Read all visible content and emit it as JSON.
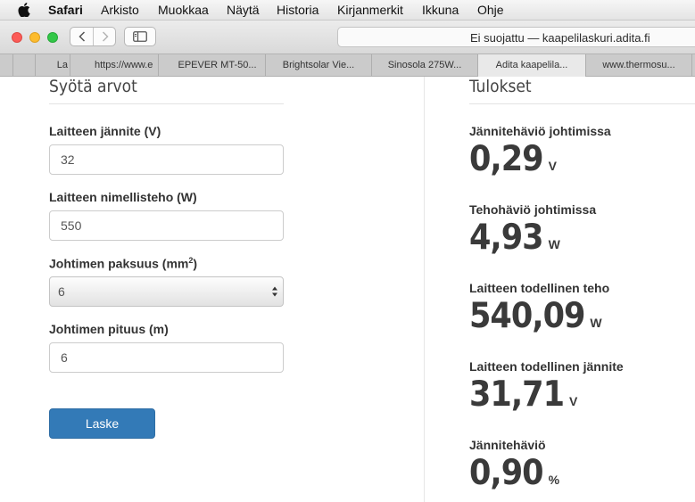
{
  "menubar": {
    "app": "Safari",
    "items": [
      "Arkisto",
      "Muokkaa",
      "Näytä",
      "Historia",
      "Kirjanmerkit",
      "Ikkuna",
      "Ohje"
    ]
  },
  "toolbar": {
    "address": "Ei suojattu — kaapelilaskuri.adita.fi"
  },
  "tabs": [
    {
      "label": "La"
    },
    {
      "label": "https://www.e"
    },
    {
      "label": "EPEVER MT-50..."
    },
    {
      "label": "Brightsolar Vie..."
    },
    {
      "label": "Sinosola 275W..."
    },
    {
      "label": "Adita kaapelila..."
    },
    {
      "label": "www.thermosu..."
    }
  ],
  "active_tab_index": 5,
  "form": {
    "title": "Syötä arvot",
    "voltage_label": "Laitteen jännite (V)",
    "voltage_value": "32",
    "power_label": "Laitteen nimellisteho (W)",
    "power_value": "550",
    "thickness_label": "Johtimen paksuus (mm",
    "thickness_sup": "2",
    "thickness_label_end": ")",
    "thickness_value": "6",
    "length_label": "Johtimen pituus (m)",
    "length_value": "6",
    "submit_label": "Laske"
  },
  "results": {
    "title": "Tulokset",
    "items": [
      {
        "label": "Jännitehäviö johtimissa",
        "value": "0,29",
        "unit": "V"
      },
      {
        "label": "Tehohäviö johtimissa",
        "value": "4,93",
        "unit": "W"
      },
      {
        "label": "Laitteen todellinen teho",
        "value": "540,09",
        "unit": "W"
      },
      {
        "label": "Laitteen todellinen jännite",
        "value": "31,71",
        "unit": "V"
      },
      {
        "label": "Jännitehäviö",
        "value": "0,90",
        "unit": "%"
      }
    ]
  }
}
